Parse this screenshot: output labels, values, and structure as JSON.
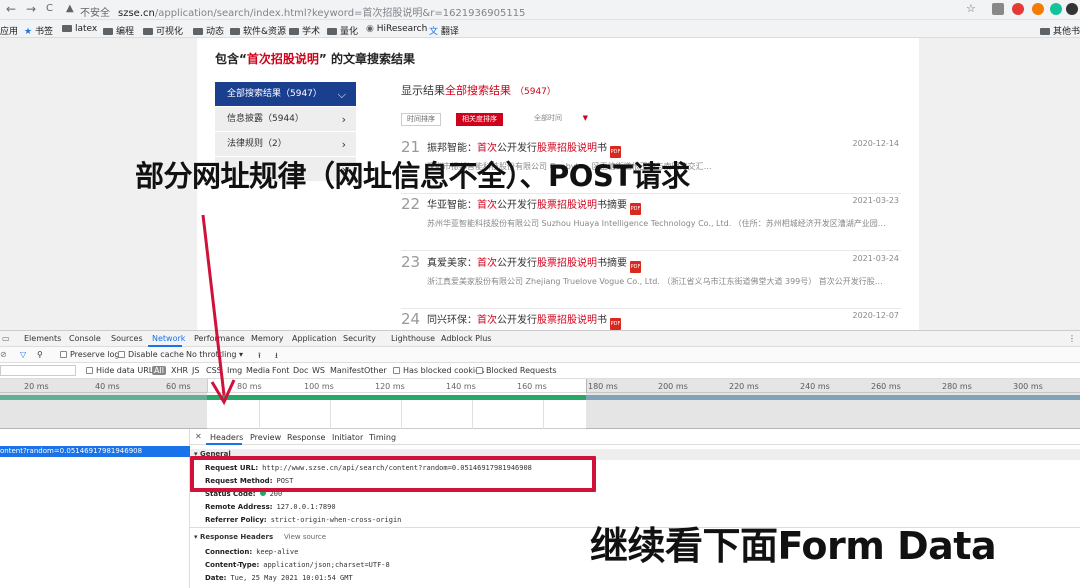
{
  "browser": {
    "nav_back": "←",
    "nav_forward": "→",
    "nav_reload": "C",
    "security_icon": "warning-triangle-icon",
    "security_text": "不安全",
    "url_host": "szse.cn",
    "url_rest": "/application/search/index.html?keyword=首次招股说明&r=1621936905115",
    "bookmarks": [
      "应用",
      "书签",
      "latex",
      "编程",
      "可视化",
      "动态",
      "软件&资源",
      "学术",
      "量化",
      "HiResearch",
      "翻译"
    ],
    "other_bookmarks": "其他书签"
  },
  "page": {
    "heading_prefix": "包含“",
    "heading_keyword": "首次招股说明",
    "heading_suffix": "” 的文章搜索结果",
    "sidebar": [
      {
        "label": "全部搜索结果（5947）",
        "active": true
      },
      {
        "label": "信息披露（5944）",
        "active": false
      },
      {
        "label": "法律规则（2）",
        "active": false
      },
      {
        "label": "",
        "active": false
      }
    ],
    "results_prefix": "显示结果",
    "results_keyword": "全部搜索结果",
    "results_count": "（5947）",
    "sort_time": "时间排序",
    "sort_relevance": "相关度排序",
    "time_filter": "全部时间",
    "results": [
      {
        "num": "21",
        "company": "振邦智能：",
        "title_a": "首次",
        "title_b": "公开发行",
        "title_c": "股票",
        "title_d": "招股说明",
        "title_e": "书",
        "date": "2020-12-14",
        "summary": "深圳市振邦智能科技股份有限公司 Genbyte…区玉塘街道根玉路与南明路交汇…"
      },
      {
        "num": "22",
        "company": "华亚智能：",
        "title_a": "首次",
        "title_b": "公开发行",
        "title_c": "股票",
        "title_d": "招股说明",
        "title_e": "书摘要",
        "date": "2021-03-23",
        "summary": "苏州华亚智能科技股份有限公司 Suzhou Huaya Intelligence Technology Co., Ltd. （住所：苏州相城经济开发区漕湖产业园…"
      },
      {
        "num": "23",
        "company": "真爱美家：",
        "title_a": "首次",
        "title_b": "公开发行",
        "title_c": "股票",
        "title_d": "招股说明",
        "title_e": "书摘要",
        "date": "2021-03-24",
        "summary": "浙江真爱美家股份有限公司 Zhejiang Truelove Vogue Co., Ltd. （浙江省义乌市江东街道佛堂大道 399号） 首次公开发行股…"
      },
      {
        "num": "24",
        "company": "同兴环保：",
        "title_a": "首次",
        "title_b": "公开发行",
        "title_c": "股票",
        "title_d": "招股说明",
        "title_e": "书",
        "date": "2020-12-07",
        "summary": ""
      }
    ]
  },
  "devtools": {
    "tabs": [
      "Elements",
      "Console",
      "Sources",
      "Network",
      "Performance",
      "Memory",
      "Application",
      "Security",
      "Lighthouse",
      "Adblock Plus"
    ],
    "toolbar": {
      "preserve_log": "Preserve log",
      "disable_cache": "Disable cache",
      "throttling": "No throttling"
    },
    "filters": {
      "hide_data_urls": "Hide data URLs",
      "all": "All",
      "types": [
        "XHR",
        "JS",
        "CSS",
        "Img",
        "Media",
        "Font",
        "Doc",
        "WS",
        "Manifest",
        "Other"
      ],
      "blocked_cookies": "Has blocked cookies",
      "blocked_requests": "Blocked Requests"
    },
    "ticks": [
      "20 ms",
      "40 ms",
      "60 ms",
      "80 ms",
      "100 ms",
      "120 ms",
      "140 ms",
      "160 ms",
      "180 ms",
      "200 ms",
      "220 ms",
      "240 ms",
      "260 ms",
      "280 ms",
      "300 ms"
    ],
    "selected_request": "ontent?random=0.05146917981946908",
    "detail_tabs": [
      "Headers",
      "Preview",
      "Response",
      "Initiator",
      "Timing"
    ],
    "general_label": "▾ General",
    "general": [
      {
        "k": "Request URL:",
        "v": "http://www.szse.cn/api/search/content?random=0.05146917981946908"
      },
      {
        "k": "Request Method:",
        "v": "POST"
      },
      {
        "k": "Status Code:",
        "v": "200"
      },
      {
        "k": "Remote Address:",
        "v": "127.0.0.1:7890"
      },
      {
        "k": "Referrer Policy:",
        "v": "strict-origin-when-cross-origin"
      }
    ],
    "response_headers_label": "▾ Response Headers",
    "view_source": "View source",
    "response": [
      {
        "k": "Connection:",
        "v": "keep-alive"
      },
      {
        "k": "Content-Type:",
        "v": "application/json;charset=UTF-8"
      },
      {
        "k": "Date:",
        "v": "Tue, 25 May 2021 10:01:54 GMT"
      }
    ]
  },
  "overlay": {
    "title": "部分网址规律（网址信息不全）、POST请求",
    "bottom": "继续看下面Form Data"
  },
  "colors": {
    "accent_red": "#d0021b",
    "nav_blue": "#1b3f8f",
    "devtools_blue": "#1a73e8",
    "highlight": "#d0113a"
  }
}
